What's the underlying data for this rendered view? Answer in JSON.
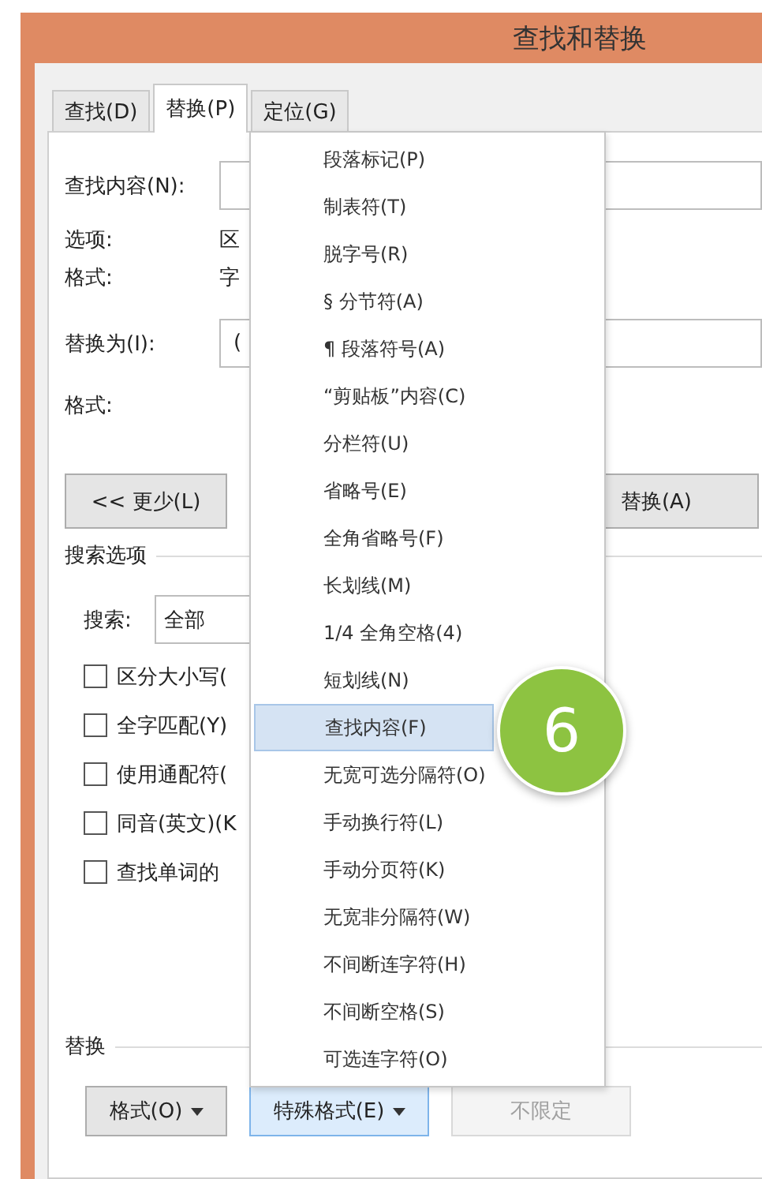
{
  "window": {
    "title": "查找和替换"
  },
  "tabs": [
    {
      "label": "查找(D)",
      "selected": false
    },
    {
      "label": "替换(P)",
      "selected": true
    },
    {
      "label": "定位(G)",
      "selected": false
    }
  ],
  "find": {
    "label": "查找内容(N):"
  },
  "options": {
    "label": "选项:",
    "value": "区"
  },
  "find_format": {
    "label": "格式:",
    "value": "字"
  },
  "replace": {
    "label": "替换为(I):",
    "value": "("
  },
  "replace_format": {
    "label": "格式:"
  },
  "buttons": {
    "less": "<< 更少(L)",
    "replace_all": "替换(A)"
  },
  "search_options": {
    "title": "搜索选项",
    "search_label": "搜索:",
    "search_value": "全部",
    "checkboxes": [
      {
        "label": "区分大小写(",
        "checked": false
      },
      {
        "label": "全字匹配(Y)",
        "checked": false
      },
      {
        "label": "使用通配符(",
        "checked": false
      },
      {
        "label": "同音(英文)(K",
        "checked": false
      },
      {
        "label": "查找单词的",
        "checked": false
      }
    ]
  },
  "replace_section": {
    "title": "替换",
    "buttons": [
      {
        "label": "格式(O)",
        "dropdown": true,
        "highlighted": false,
        "disabled": false
      },
      {
        "label": "特殊格式(E)",
        "dropdown": true,
        "highlighted": true,
        "disabled": false
      },
      {
        "label": "不限定",
        "dropdown": false,
        "highlighted": false,
        "disabled": true
      }
    ]
  },
  "menu": {
    "items": [
      {
        "label": "段落标记(P)",
        "selected": false
      },
      {
        "label": "制表符(T)",
        "selected": false
      },
      {
        "label": "脱字号(R)",
        "selected": false
      },
      {
        "label": "§ 分节符(A)",
        "selected": false
      },
      {
        "label": "¶ 段落符号(A)",
        "selected": false
      },
      {
        "label": "“剪贴板”内容(C)",
        "selected": false
      },
      {
        "label": "分栏符(U)",
        "selected": false
      },
      {
        "label": "省略号(E)",
        "selected": false
      },
      {
        "label": "全角省略号(F)",
        "selected": false
      },
      {
        "label": "长划线(M)",
        "selected": false
      },
      {
        "label": "1/4 全角空格(4)",
        "selected": false
      },
      {
        "label": "短划线(N)",
        "selected": false
      },
      {
        "label": "查找内容(F)",
        "selected": true
      },
      {
        "label": "无宽可选分隔符(O)",
        "selected": false
      },
      {
        "label": "手动换行符(L)",
        "selected": false
      },
      {
        "label": "手动分页符(K)",
        "selected": false
      },
      {
        "label": "无宽非分隔符(W)",
        "selected": false
      },
      {
        "label": "不间断连字符(H)",
        "selected": false
      },
      {
        "label": "不间断空格(S)",
        "selected": false
      },
      {
        "label": "可选连字符(O)",
        "selected": false
      }
    ]
  },
  "callout": {
    "label": "6"
  }
}
